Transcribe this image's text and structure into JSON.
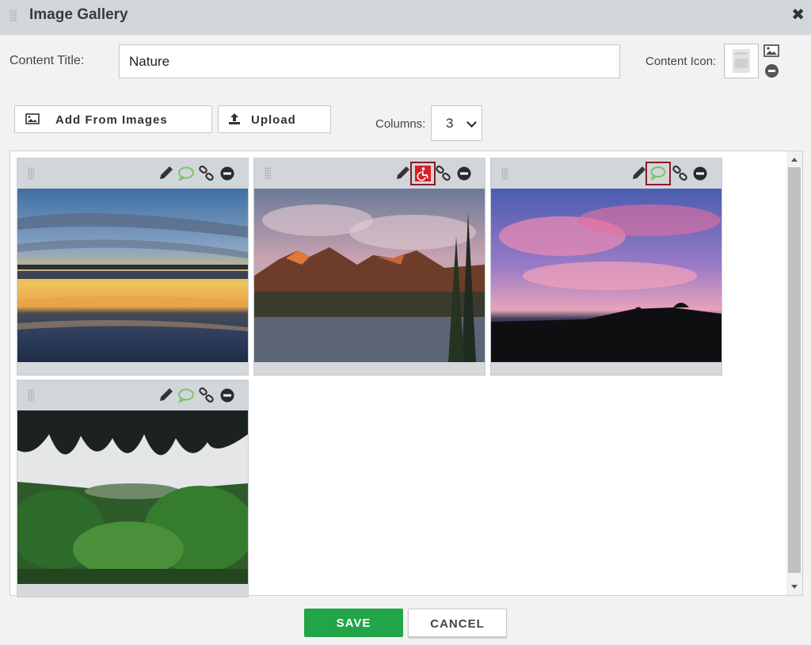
{
  "window": {
    "title": "Image Gallery"
  },
  "form": {
    "content_title_label": "Content Title:",
    "content_title_value": "Nature",
    "content_icon_label": "Content Icon:"
  },
  "toolbar": {
    "add_from_images_label": "Add From Images",
    "upload_label": "Upload",
    "columns_label": "Columns:",
    "columns_value": "3"
  },
  "gallery": {
    "items": [
      {
        "name": "sunset-lake",
        "highlighted_tool": "none",
        "caption_icon_color": "#7cc36b"
      },
      {
        "name": "mountain-river",
        "highlighted_tool": "accessibility",
        "caption_icon_color": "#7cc36b"
      },
      {
        "name": "pink-sky-prairie",
        "highlighted_tool": "caption",
        "caption_icon_color": "#7cc36b"
      },
      {
        "name": "jungle-cave",
        "highlighted_tool": "none",
        "caption_icon_color": "#7cc36b"
      }
    ]
  },
  "footer": {
    "save_label": "SAVE",
    "cancel_label": "CANCEL"
  },
  "colors": {
    "save": "#22a548",
    "highlight_border": "#8a1a25",
    "accessibility": "#d62128",
    "caption_icon": "#7cc36b"
  }
}
